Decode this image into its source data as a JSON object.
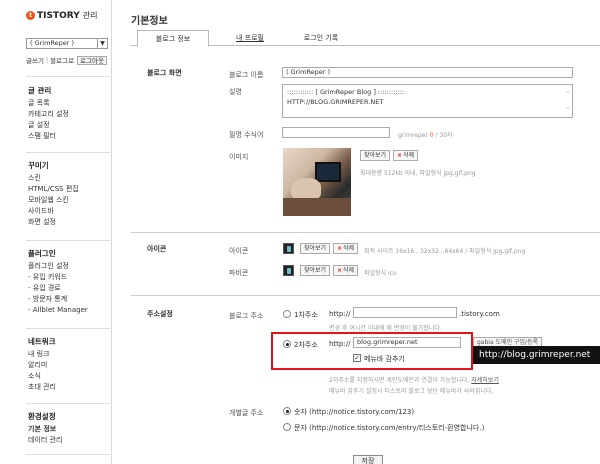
{
  "sidebar": {
    "logo_text": "TISTORY",
    "logo_sub": "관리",
    "blog_select_value": "( GrimReper )",
    "quick_links": [
      "글쓰기",
      "블로그로"
    ],
    "logout_label": "로그아웃",
    "sections": [
      {
        "title": "글 관리",
        "items": [
          "글 목록",
          "카테고리 설정",
          "글 설정",
          "스팸 필터"
        ]
      },
      {
        "title": "꾸미기",
        "items": [
          "스킨",
          "HTML/CSS 편집",
          "모바일웹 스킨",
          "사이드바",
          "화면 설정"
        ]
      },
      {
        "title": "플러그인",
        "items": [
          "플러그인 설정",
          "- 유입 키워드",
          "- 유입 경로",
          "- 방문자 통계",
          "- Allblet Manager"
        ]
      },
      {
        "title": "네트워크",
        "items": [
          "내 링크",
          "알리미",
          "소식",
          "초대 관리"
        ]
      },
      {
        "title": "환경설정",
        "items": [
          "기본 정보",
          "데이터 관리"
        ]
      }
    ]
  },
  "main": {
    "title": "기본정보",
    "tabs": [
      "블로그 정보",
      "내 프로필",
      "로그인 기록"
    ],
    "blog_screen": {
      "section_label": "블로그 화면",
      "name_label": "블로그 이름",
      "name_value": "( GrimReper )",
      "desc_label": "설명",
      "desc_line1": "::::::::::::  [ GrimReper Blog ]  ::::::::::::",
      "desc_line2": "HTTP://BLOG.GRIMREPER.NET",
      "nickname_label": "필명 수식어",
      "nickname_hint_name": "grimreper",
      "nickname_hint_count": "0",
      "nickname_hint_max": "/ 30자",
      "image_label": "이미지",
      "find_label": "찾아보기",
      "delete_label": "삭제",
      "image_hint": "최대용량 512kb 이내, 파일형식 jpg,gif,png"
    },
    "icons": {
      "section_label": "아이콘",
      "icon_label": "아이콘",
      "icon_hint": "최적 사이즈 16x16 , 32x32 , 64x64 / 파일형식 jpg,gif,png",
      "favicon_label": "파비콘",
      "favicon_hint": "파일형식 ico"
    },
    "address": {
      "section_label": "주소설정",
      "blog_addr_label": "블로그 주소",
      "primary_label": "1차주소",
      "http_prefix": "http://",
      "primary_value": "",
      "primary_suffix": ".tistory.com",
      "primary_note": "변경 후 여시간 이내에 재 변경이 불가합니다.",
      "secondary_label": "2차주소",
      "secondary_value": "blog.grimreper.net",
      "domain_button": "gabia 도메인 구입/등록",
      "hide_menu_label": "메뉴바 감추기",
      "secondary_note1": "2차주소를 지정하시면 개인도메인과 연결이 가능합니다.",
      "secondary_note_link": "자세히보기",
      "secondary_note2": "메뉴바 감추기 설정시 티스토리 블로그 상단 메뉴바가 사라집니다.",
      "post_addr_label": "개별글 주소",
      "post_opt_number": "숫자 (http://notice.tistory.com/123)",
      "post_opt_text": "문자 (http://notice.tistory.com/entry/티스토리-환영합니다.)"
    },
    "save_label": "저장",
    "watermark": "http://blog.grimreper.net"
  }
}
